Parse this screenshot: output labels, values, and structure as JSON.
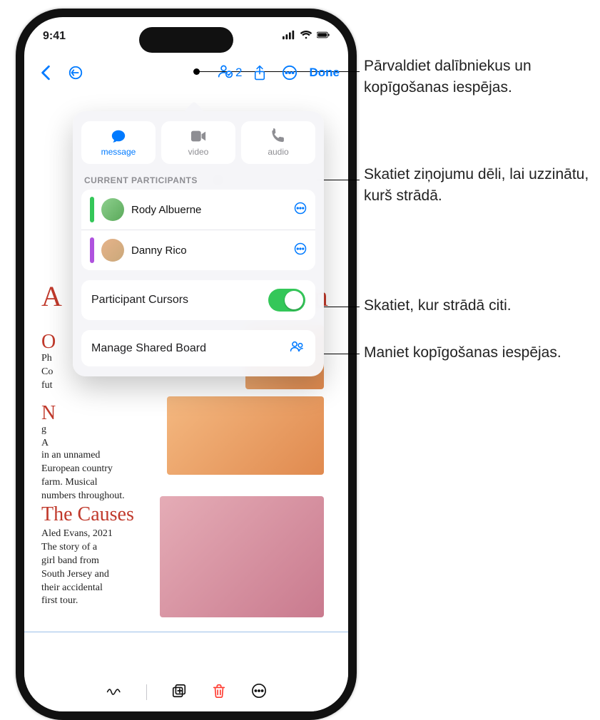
{
  "status": {
    "time": "9:41"
  },
  "toolbar": {
    "participant_count": "2",
    "done": "Done"
  },
  "popover": {
    "comm": {
      "message": "message",
      "video": "video",
      "audio": "audio"
    },
    "participants_header": "CURRENT PARTICIPANTS",
    "participants": [
      {
        "name": "Rody Albuerne"
      },
      {
        "name": "Danny Rico"
      }
    ],
    "cursors_label": "Participant Cursors",
    "manage_label": "Manage Shared Board"
  },
  "board": {
    "title_fragment_left": "A",
    "title_fragment_right": "eam",
    "section1_head": "O",
    "section1_body": "Ph\nCo\nfut",
    "section2_head": "N",
    "section2_intro": "g\nA",
    "section2_body": "in an unnamed\nEuropean country\nfarm. Musical\nnumbers throughout.",
    "causes_head": "The Causes",
    "causes_body": "Aled Evans, 2021\nThe story of a\ngirl band from\nSouth Jersey and\ntheir accidental\nfirst tour."
  },
  "callouts": {
    "c1": "Pārvaldiet dalībniekus un kopīgošanas iespējas.",
    "c2": "Skatiet ziņojumu dēli, lai uzzinātu, kurš strādā.",
    "c3": "Skatiet, kur strādā citi.",
    "c4": "Maniet kopīgošanas iespējas."
  }
}
